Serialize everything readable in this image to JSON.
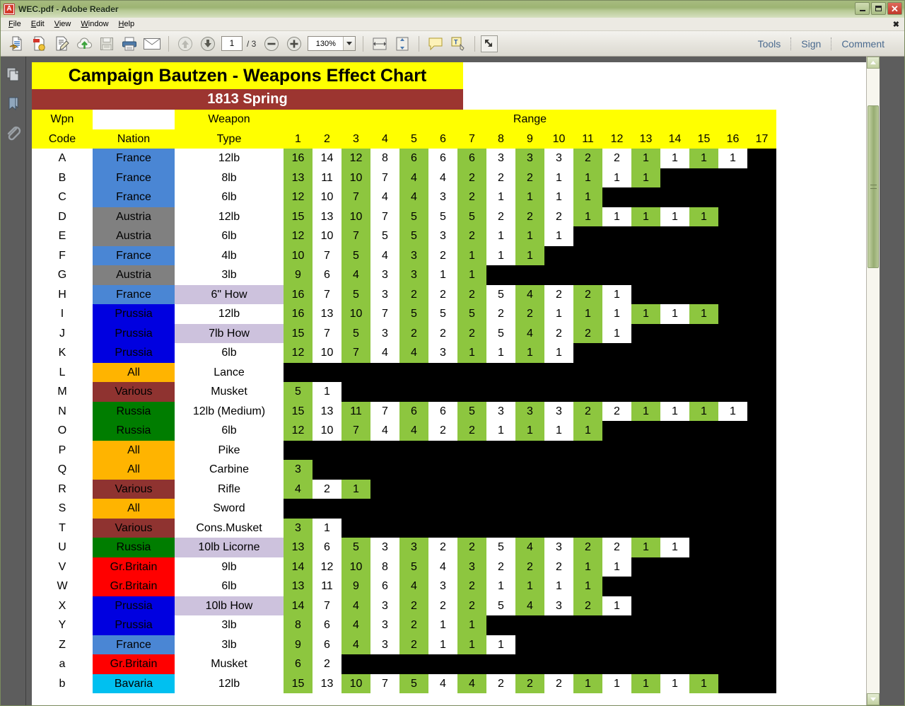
{
  "window": {
    "title": "WEC.pdf - Adobe Reader",
    "app_icon": "pdf-icon",
    "minimize_label": "Minimize",
    "maximize_label": "Restore",
    "close_label": "Close"
  },
  "menubar": {
    "items": [
      "File",
      "Edit",
      "View",
      "Window",
      "Help"
    ],
    "close_glyph": "✖"
  },
  "toolbar": {
    "icons": [
      "open-file-icon",
      "create-pdf-icon",
      "edit-pdf-icon",
      "upload-cloud-icon",
      "save-icon",
      "print-icon",
      "email-icon"
    ],
    "nav_icons": [
      "previous-page-icon",
      "next-page-icon"
    ],
    "page_value": "1",
    "page_total": "/ 3",
    "zoom_out_icon": "zoom-out-icon",
    "zoom_in_icon": "zoom-in-icon",
    "zoom_value": "130%",
    "view_icons": [
      "fit-width-icon",
      "fit-page-icon",
      "fullscreen-icon"
    ],
    "comment_icons": [
      "sticky-note-icon",
      "text-edit-icon"
    ],
    "links": [
      "Tools",
      "Sign",
      "Comment"
    ]
  },
  "navpane": {
    "icons": [
      "page-thumbnails-icon",
      "bookmarks-icon",
      "attachments-icon"
    ]
  },
  "scrollbar": {
    "up_label": "Scroll up",
    "down_label": "Scroll down",
    "thumb_label": "Scroll thumb"
  },
  "chart_data": {
    "type": "table",
    "title": "Campaign Bautzen - Weapons Effect Chart",
    "subtitle": "1813 Spring",
    "header": {
      "code_line1": "Wpn",
      "code_line2": "Code",
      "nation_line1": "",
      "nation_line2": "Nation",
      "type_line1": "Weapon",
      "type_line2": "Type",
      "range_label": "Range"
    },
    "range_columns": [
      "1",
      "2",
      "3",
      "4",
      "5",
      "6",
      "7",
      "8",
      "9",
      "10",
      "11",
      "12",
      "13",
      "14",
      "15",
      "16",
      "17"
    ],
    "rows": [
      {
        "code": "A",
        "nation": "France",
        "nation_class": "n-france",
        "type": "12lb",
        "how": false,
        "values": [
          16,
          14,
          12,
          8,
          6,
          6,
          6,
          3,
          3,
          3,
          2,
          2,
          1,
          1,
          1,
          1,
          null
        ]
      },
      {
        "code": "B",
        "nation": "France",
        "nation_class": "n-france",
        "type": "8lb",
        "how": false,
        "values": [
          13,
          11,
          10,
          7,
          4,
          4,
          2,
          2,
          2,
          1,
          1,
          1,
          1,
          null,
          null,
          null,
          null
        ]
      },
      {
        "code": "C",
        "nation": "France",
        "nation_class": "n-france",
        "type": "6lb",
        "how": false,
        "values": [
          12,
          10,
          7,
          4,
          4,
          3,
          2,
          1,
          1,
          1,
          1,
          null,
          null,
          null,
          null,
          null,
          null
        ]
      },
      {
        "code": "D",
        "nation": "Austria",
        "nation_class": "n-austria",
        "type": "12lb",
        "how": false,
        "values": [
          15,
          13,
          10,
          7,
          5,
          5,
          5,
          2,
          2,
          2,
          1,
          1,
          1,
          1,
          1,
          null,
          null
        ]
      },
      {
        "code": "E",
        "nation": "Austria",
        "nation_class": "n-austria",
        "type": "6lb",
        "how": false,
        "values": [
          12,
          10,
          7,
          5,
          5,
          3,
          2,
          1,
          1,
          1,
          null,
          null,
          null,
          null,
          null,
          null,
          null
        ]
      },
      {
        "code": "F",
        "nation": "France",
        "nation_class": "n-france",
        "type": "4lb",
        "how": false,
        "values": [
          10,
          7,
          5,
          4,
          3,
          2,
          1,
          1,
          1,
          null,
          null,
          null,
          null,
          null,
          null,
          null,
          null
        ]
      },
      {
        "code": "G",
        "nation": "Austria",
        "nation_class": "n-austria",
        "type": "3lb",
        "how": false,
        "values": [
          9,
          6,
          4,
          3,
          3,
          1,
          1,
          null,
          null,
          null,
          null,
          null,
          null,
          null,
          null,
          null,
          null
        ]
      },
      {
        "code": "H",
        "nation": "France",
        "nation_class": "n-france",
        "type": "6\" How",
        "how": true,
        "values": [
          16,
          7,
          5,
          3,
          2,
          2,
          2,
          5,
          4,
          2,
          2,
          1,
          null,
          null,
          null,
          null,
          null
        ]
      },
      {
        "code": "I",
        "nation": "Prussia",
        "nation_class": "n-prussia",
        "type": "12lb",
        "how": false,
        "values": [
          16,
          13,
          10,
          7,
          5,
          5,
          5,
          2,
          2,
          1,
          1,
          1,
          1,
          1,
          1,
          null,
          null
        ]
      },
      {
        "code": "J",
        "nation": "Prussia",
        "nation_class": "n-prussia",
        "type": "7lb How",
        "how": true,
        "values": [
          15,
          7,
          5,
          3,
          2,
          2,
          2,
          5,
          4,
          2,
          2,
          1,
          null,
          null,
          null,
          null,
          null
        ]
      },
      {
        "code": "K",
        "nation": "Prussia",
        "nation_class": "n-prussia",
        "type": "6lb",
        "how": false,
        "values": [
          12,
          10,
          7,
          4,
          4,
          3,
          1,
          1,
          1,
          1,
          null,
          null,
          null,
          null,
          null,
          null,
          null
        ]
      },
      {
        "code": "L",
        "nation": "All",
        "nation_class": "n-all",
        "type": "Lance",
        "how": false,
        "values": [
          null,
          null,
          null,
          null,
          null,
          null,
          null,
          null,
          null,
          null,
          null,
          null,
          null,
          null,
          null,
          null,
          null
        ]
      },
      {
        "code": "M",
        "nation": "Various",
        "nation_class": "n-various",
        "type": "Musket",
        "how": false,
        "values": [
          5,
          1,
          null,
          null,
          null,
          null,
          null,
          null,
          null,
          null,
          null,
          null,
          null,
          null,
          null,
          null,
          null
        ]
      },
      {
        "code": "N",
        "nation": "Russia",
        "nation_class": "n-russia",
        "type": "12lb (Medium)",
        "how": false,
        "values": [
          15,
          13,
          11,
          7,
          6,
          6,
          5,
          3,
          3,
          3,
          2,
          2,
          1,
          1,
          1,
          1,
          null
        ]
      },
      {
        "code": "O",
        "nation": "Russia",
        "nation_class": "n-russia",
        "type": "6lb",
        "how": false,
        "values": [
          12,
          10,
          7,
          4,
          4,
          2,
          2,
          1,
          1,
          1,
          1,
          null,
          null,
          null,
          null,
          null,
          null
        ]
      },
      {
        "code": "P",
        "nation": "All",
        "nation_class": "n-all",
        "type": "Pike",
        "how": false,
        "values": [
          null,
          null,
          null,
          null,
          null,
          null,
          null,
          null,
          null,
          null,
          null,
          null,
          null,
          null,
          null,
          null,
          null
        ]
      },
      {
        "code": "Q",
        "nation": "All",
        "nation_class": "n-all",
        "type": "Carbine",
        "how": false,
        "values": [
          3,
          null,
          null,
          null,
          null,
          null,
          null,
          null,
          null,
          null,
          null,
          null,
          null,
          null,
          null,
          null,
          null
        ]
      },
      {
        "code": "R",
        "nation": "Various",
        "nation_class": "n-various",
        "type": "Rifle",
        "how": false,
        "values": [
          4,
          2,
          1,
          null,
          null,
          null,
          null,
          null,
          null,
          null,
          null,
          null,
          null,
          null,
          null,
          null,
          null
        ]
      },
      {
        "code": "S",
        "nation": "All",
        "nation_class": "n-all",
        "type": "Sword",
        "how": false,
        "values": [
          null,
          null,
          null,
          null,
          null,
          null,
          null,
          null,
          null,
          null,
          null,
          null,
          null,
          null,
          null,
          null,
          null
        ]
      },
      {
        "code": "T",
        "nation": "Various",
        "nation_class": "n-various",
        "type": "Cons.Musket",
        "how": false,
        "values": [
          3,
          1,
          null,
          null,
          null,
          null,
          null,
          null,
          null,
          null,
          null,
          null,
          null,
          null,
          null,
          null,
          null
        ]
      },
      {
        "code": "U",
        "nation": "Russia",
        "nation_class": "n-russia",
        "type": "10lb Licorne",
        "how": true,
        "values": [
          13,
          6,
          5,
          3,
          3,
          2,
          2,
          5,
          4,
          3,
          2,
          2,
          1,
          1,
          null,
          null,
          null
        ]
      },
      {
        "code": "V",
        "nation": "Gr.Britain",
        "nation_class": "n-britain",
        "type": "9lb",
        "how": false,
        "values": [
          14,
          12,
          10,
          8,
          5,
          4,
          3,
          2,
          2,
          2,
          1,
          1,
          null,
          null,
          null,
          null,
          null
        ]
      },
      {
        "code": "W",
        "nation": "Gr.Britain",
        "nation_class": "n-britain",
        "type": "6lb",
        "how": false,
        "values": [
          13,
          11,
          9,
          6,
          4,
          3,
          2,
          1,
          1,
          1,
          1,
          null,
          null,
          null,
          null,
          null,
          null
        ]
      },
      {
        "code": "X",
        "nation": "Prussia",
        "nation_class": "n-prussia",
        "type": "10lb How",
        "how": true,
        "values": [
          14,
          7,
          4,
          3,
          2,
          2,
          2,
          5,
          4,
          3,
          2,
          1,
          null,
          null,
          null,
          null,
          null
        ]
      },
      {
        "code": "Y",
        "nation": "Prussia",
        "nation_class": "n-prussia",
        "type": "3lb",
        "how": false,
        "values": [
          8,
          6,
          4,
          3,
          2,
          1,
          1,
          null,
          null,
          null,
          null,
          null,
          null,
          null,
          null,
          null,
          null
        ]
      },
      {
        "code": "Z",
        "nation": "France",
        "nation_class": "n-france",
        "type": "3lb",
        "how": false,
        "values": [
          9,
          6,
          4,
          3,
          2,
          1,
          1,
          1,
          null,
          null,
          null,
          null,
          null,
          null,
          null,
          null,
          null
        ]
      },
      {
        "code": "a",
        "nation": "Gr.Britain",
        "nation_class": "n-britain",
        "type": "Musket",
        "how": false,
        "values": [
          6,
          2,
          null,
          null,
          null,
          null,
          null,
          null,
          null,
          null,
          null,
          null,
          null,
          null,
          null,
          null,
          null
        ]
      },
      {
        "code": "b",
        "nation": "Bavaria",
        "nation_class": "n-bavaria",
        "type": "12lb",
        "how": false,
        "values": [
          15,
          13,
          10,
          7,
          5,
          4,
          4,
          2,
          2,
          2,
          1,
          1,
          1,
          1,
          1,
          null,
          null
        ]
      }
    ],
    "colors": {
      "title_bg": "#ffff00",
      "subtitle_bg": "#9c3530",
      "value_green": "#8dc63f",
      "value_white": "#ffffff",
      "no_effect": "#000000",
      "howitzer_row": "#cdc2dd",
      "france": "#4a86d4",
      "austria": "#808080",
      "prussia": "#0000e0",
      "russia": "#007d00",
      "all": "#ffb400",
      "various": "#8f3330",
      "gr_britain": "#ff0000",
      "bavaria": "#00c0f0"
    }
  }
}
